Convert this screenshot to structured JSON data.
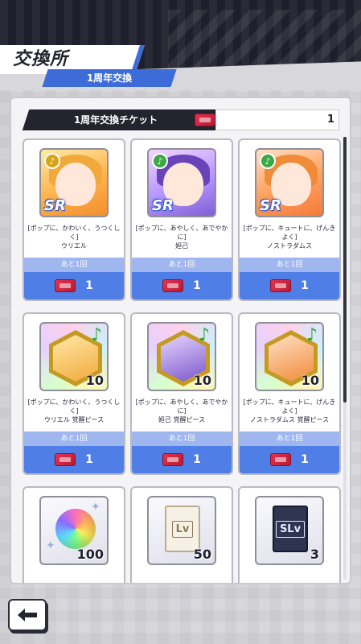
{
  "header": {
    "title": "交換所",
    "subtitle": "1周年交換"
  },
  "ticket": {
    "label": "1周年交換チケット",
    "count": "1"
  },
  "items": [
    {
      "name": "[ポップに、かわいく、うつくしく]\nウリエル",
      "remaining": "あと1回",
      "cost": "1",
      "rarity": "SR"
    },
    {
      "name": "[ポップに、あやしく、あでやかに]\n妲己",
      "remaining": "あと1回",
      "cost": "1",
      "rarity": "SR"
    },
    {
      "name": "[ポップに、キュートに、げんきよく]\nノストラダムス",
      "remaining": "あと1回",
      "cost": "1",
      "rarity": "SR"
    },
    {
      "name": "[ポップに、かわいく、うつくしく]\nウリエル 覚醒ピース",
      "remaining": "あと1回",
      "cost": "1",
      "quantity": "10"
    },
    {
      "name": "[ポップに、あやしく、あでやかに]\n妲己 覚醒ピース",
      "remaining": "あと1回",
      "cost": "1",
      "quantity": "10"
    },
    {
      "name": "[ポップに、キュートに、げんきよく]\nノストラダムス 覚醒ピース",
      "remaining": "あと1回",
      "cost": "1",
      "quantity": "10"
    },
    {
      "quantity": "100",
      "book_label": ""
    },
    {
      "quantity": "50",
      "book_label": "Lv"
    },
    {
      "quantity": "3",
      "book_label": "SLv"
    }
  ],
  "icons": {
    "back": "back-arrow-icon",
    "ticket": "ticket-icon"
  },
  "colors": {
    "accent": "#4f7ee6",
    "header_dark": "#23242e",
    "ticket_red": "#d32640"
  }
}
